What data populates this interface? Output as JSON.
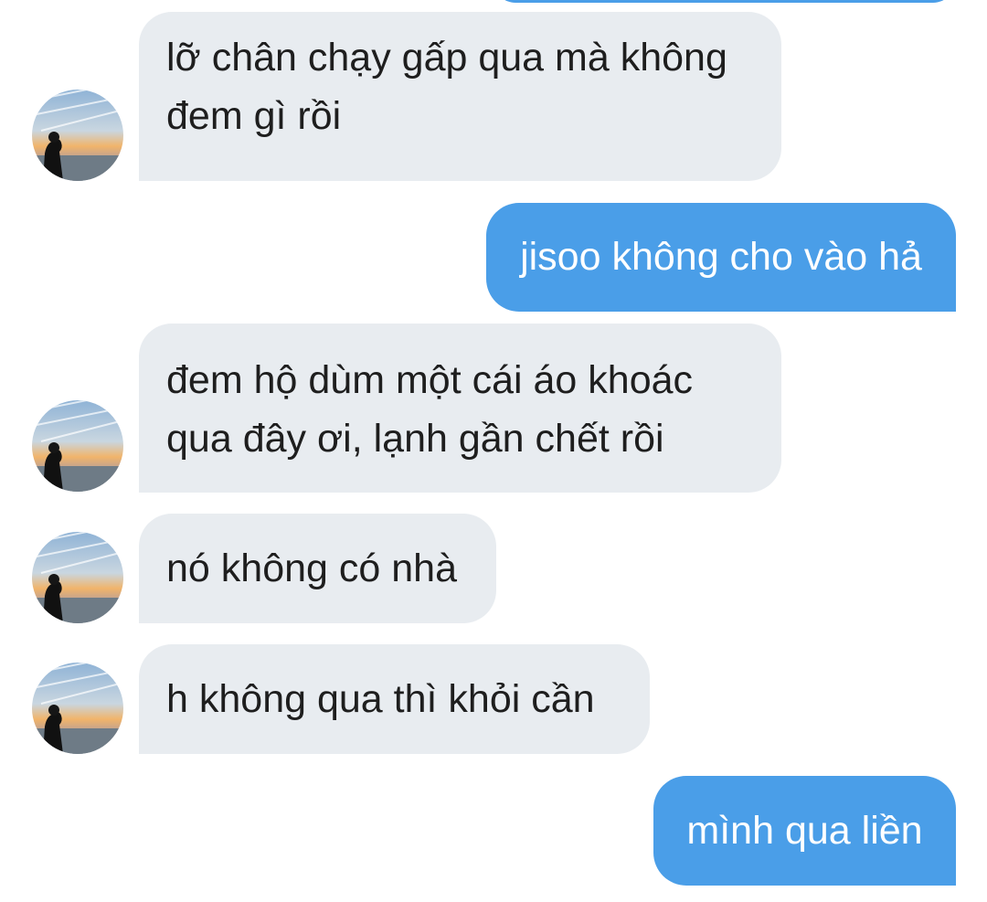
{
  "conversation": {
    "messages": [
      {
        "sender": "them",
        "lines": [
          "lỡ chân chạy gấp qua mà không",
          "đem gì rồi"
        ]
      },
      {
        "sender": "me",
        "lines": [
          "jisoo không cho vào hả"
        ]
      },
      {
        "sender": "them",
        "lines": [
          "đem hộ dùm một cái áo khoác",
          "qua đây ơi, lạnh gần chết rồi"
        ]
      },
      {
        "sender": "them",
        "lines": [
          "nó không có nhà"
        ]
      },
      {
        "sender": "them",
        "lines": [
          "h không qua thì khỏi cần"
        ]
      },
      {
        "sender": "me",
        "lines": [
          "mình qua liền"
        ]
      }
    ]
  },
  "colors": {
    "incoming_bubble": "#e8ecf0",
    "outgoing_bubble": "#4a9ee8",
    "incoming_text": "#1e1e1e",
    "outgoing_text": "#ffffff"
  },
  "avatar": {
    "icon": "profile-photo-sunset-beach"
  }
}
